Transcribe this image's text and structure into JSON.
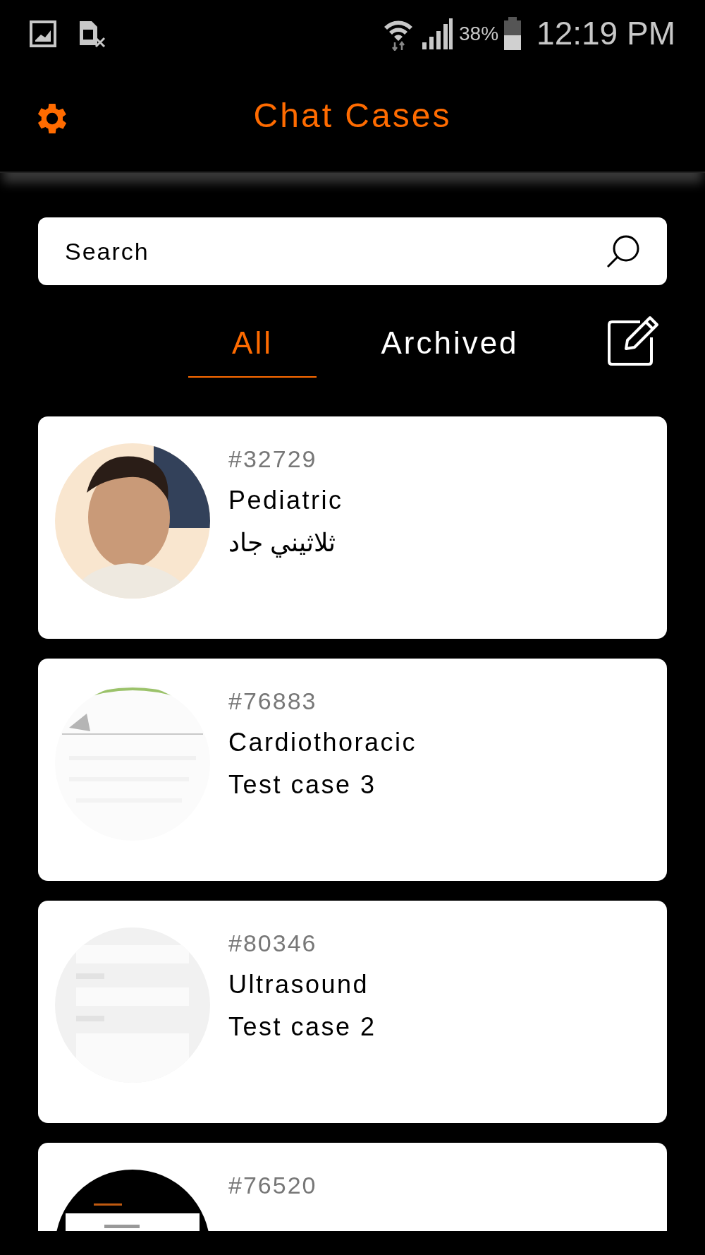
{
  "status_bar": {
    "battery": "38%",
    "time": "12:19 PM"
  },
  "header": {
    "title": "Chat Cases"
  },
  "search": {
    "placeholder": "Search"
  },
  "tabs": [
    {
      "label": "All",
      "selected": true
    },
    {
      "label": "Archived",
      "selected": false
    }
  ],
  "cases": [
    {
      "number": "#32729",
      "specialty": "Pediatric",
      "subject": "ثلاثيني جاد",
      "kind": "picture"
    },
    {
      "number": "#76883",
      "specialty": "Cardiothoracic",
      "subject": "Test case 3",
      "kind": "picture"
    },
    {
      "number": "#80346",
      "specialty": "Ultrasound",
      "subject": "Test case 2",
      "kind": "picture"
    },
    {
      "number": "#76520",
      "kind": "picture"
    }
  ]
}
